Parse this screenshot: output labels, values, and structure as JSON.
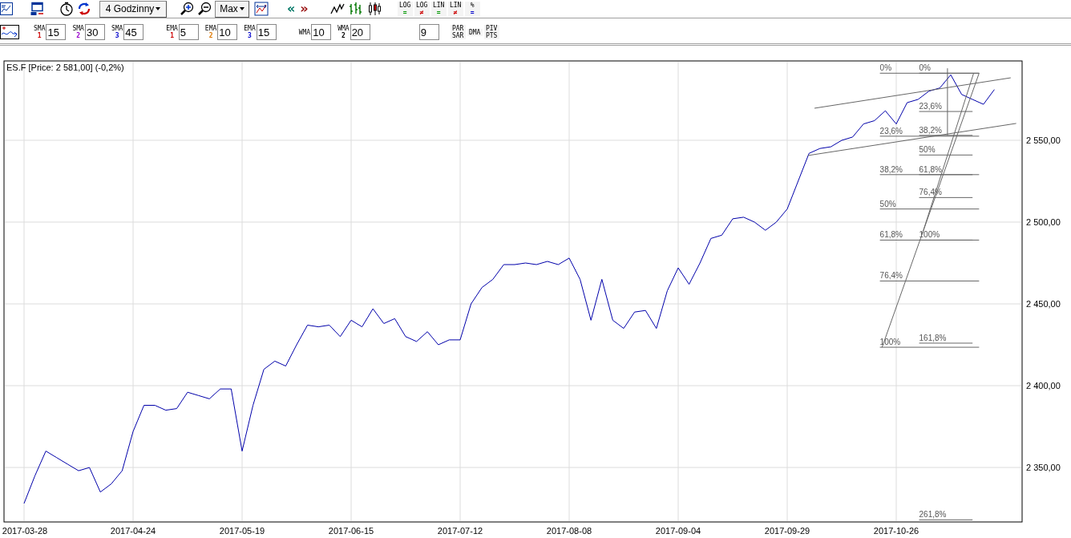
{
  "toolbar": {
    "interval": "4 Godzinny",
    "range": "Max",
    "nav_prev": "«",
    "nav_next": "»",
    "scale_buttons": [
      {
        "top": "LOG",
        "bottom": "=",
        "color": "#009900"
      },
      {
        "top": "LOG",
        "bottom": "≠",
        "color": "#cc0000"
      },
      {
        "top": "LIN",
        "bottom": "=",
        "color": "#009900"
      },
      {
        "top": "LIN",
        "bottom": "≠",
        "color": "#cc0000"
      },
      {
        "top": "%",
        "bottom": "=",
        "color": "#0000cc"
      }
    ]
  },
  "indicators": [
    {
      "label": "SMA",
      "index": "1",
      "value": "15",
      "color": "#cc0000"
    },
    {
      "label": "SMA",
      "index": "2",
      "value": "30",
      "color": "#9900cc"
    },
    {
      "label": "SMA",
      "index": "3",
      "value": "45",
      "color": "#0000cc"
    },
    {
      "label": "EMA",
      "index": "1",
      "value": "5",
      "color": "#cc0000"
    },
    {
      "label": "EMA",
      "index": "2",
      "value": "10",
      "color": "#dd7700"
    },
    {
      "label": "EMA",
      "index": "3",
      "value": "15",
      "color": "#0000cc"
    },
    {
      "label": "WMA",
      "value": "10"
    },
    {
      "label": "WMA",
      "index": "2",
      "value": "20",
      "color": "#000000"
    },
    {
      "value": "9"
    }
  ],
  "study_buttons": [
    [
      "PAR",
      "SAR"
    ],
    [
      "DMA"
    ],
    [
      "PIV",
      "PTS"
    ]
  ],
  "chart": {
    "title": "ES.F [Price: 2 581,00] (-0,2%)",
    "chart_data": {
      "type": "line",
      "categories": [
        "2017-03-28",
        null,
        null,
        null,
        null,
        null,
        null,
        null,
        null,
        null,
        "2017-04-24",
        null,
        null,
        null,
        null,
        null,
        null,
        null,
        null,
        null,
        "2017-05-19",
        null,
        null,
        null,
        null,
        null,
        null,
        null,
        null,
        null,
        "2017-06-15",
        null,
        null,
        null,
        null,
        null,
        null,
        null,
        null,
        null,
        "2017-07-12",
        null,
        null,
        null,
        null,
        null,
        null,
        null,
        null,
        null,
        "2017-08-08",
        null,
        null,
        null,
        null,
        null,
        null,
        null,
        null,
        null,
        "2017-09-04",
        null,
        null,
        null,
        null,
        null,
        null,
        null,
        null,
        null,
        "2017-09-29",
        null,
        null,
        null,
        null,
        null,
        null,
        null,
        null,
        null,
        "2017-10-26",
        null,
        null,
        null,
        null,
        null,
        null,
        null,
        null,
        null
      ],
      "series": [
        {
          "color": "#0000aa",
          "values": [
            2328,
            2345,
            2360,
            2356,
            2352,
            2348,
            2350,
            2335,
            2340,
            2348,
            2372,
            2388,
            2388,
            2385,
            2386,
            2396,
            2394,
            2392,
            2398,
            2398,
            2360,
            2388,
            2410,
            2415,
            2412,
            2425,
            2437,
            2436,
            2437,
            2430,
            2440,
            2436,
            2447,
            2438,
            2441,
            2430,
            2427,
            2433,
            2425,
            2428,
            2428,
            2450,
            2460,
            2465,
            2474,
            2474,
            2475,
            2474,
            2476,
            2474,
            2478,
            2465,
            2440,
            2465,
            2440,
            2435,
            2445,
            2446,
            2435,
            2458,
            2472,
            2462,
            2475,
            2490,
            2492,
            2502,
            2503,
            2500,
            2495,
            2500,
            2508,
            2525,
            2542,
            2545,
            2546,
            2550,
            2552,
            2560,
            2562,
            2568,
            2560,
            2573,
            2575,
            2580,
            2582,
            2590,
            2578,
            2575,
            2572,
            2581
          ]
        }
      ],
      "ylim": [
        2316.7,
        2598.5
      ],
      "grid": true,
      "yticks": [
        {
          "value": 2350,
          "label": "2 350,00"
        },
        {
          "value": 2400,
          "label": "2 400,00"
        },
        {
          "value": 2450,
          "label": "2 450,00"
        },
        {
          "value": 2500,
          "label": "2 500,00"
        },
        {
          "value": 2550,
          "label": "2 550,00"
        }
      ],
      "annotations": [
        "0%",
        "23,6%",
        "38,2%",
        "50%",
        "61,8%",
        "76,4%",
        "100%",
        "0%",
        "23,6%",
        "38,2%",
        "50%",
        "61,8%",
        "76,4%",
        "100%",
        "161,8%",
        "261,8%"
      ]
    }
  }
}
